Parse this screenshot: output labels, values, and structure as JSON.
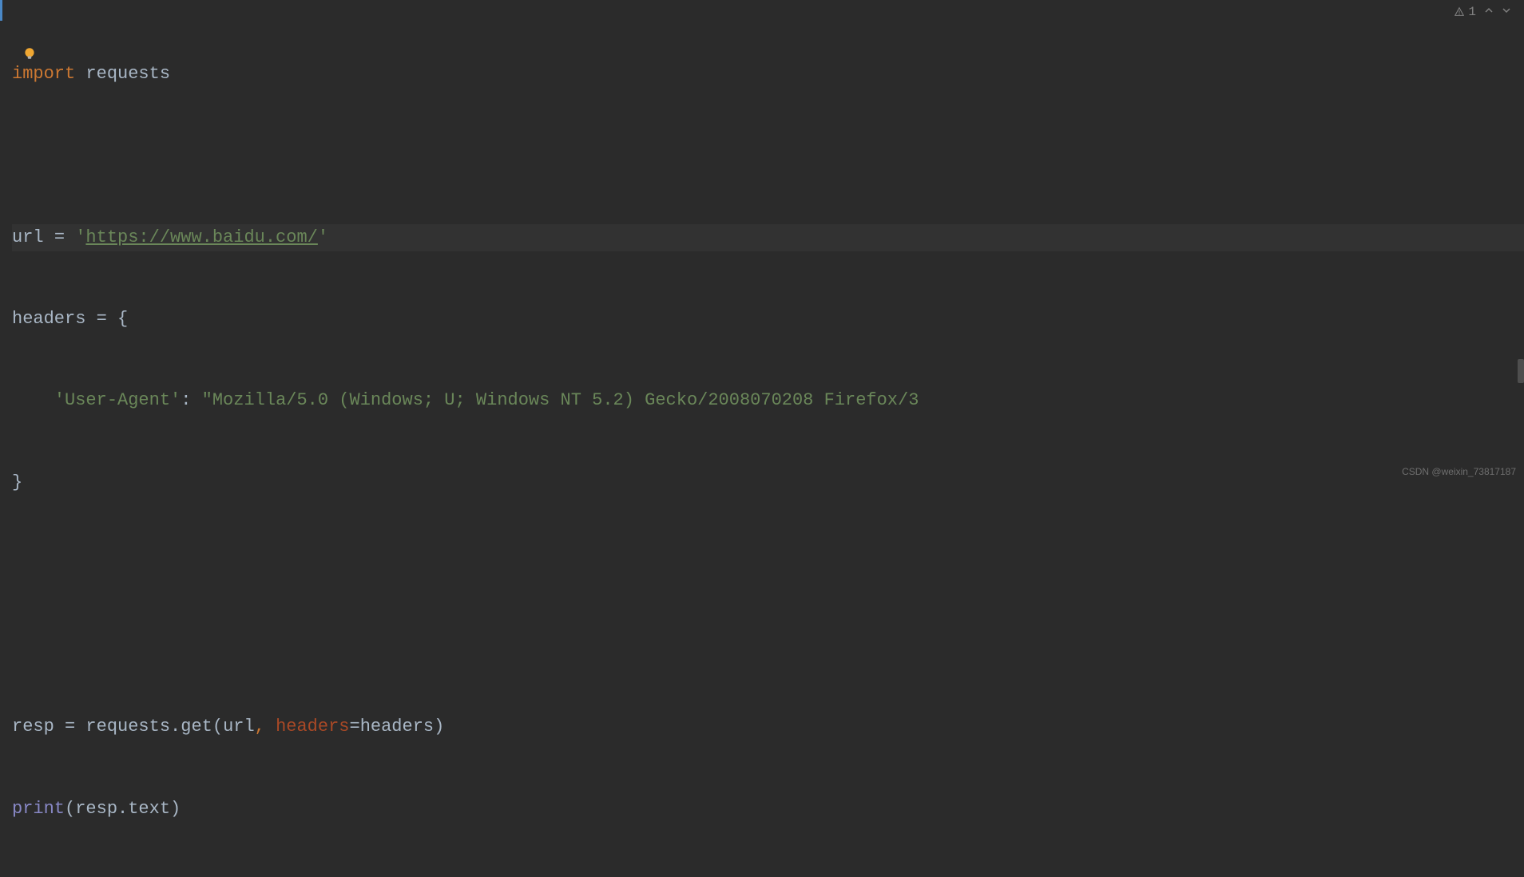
{
  "topbar": {
    "warning_count": "1",
    "chevron_up": "^",
    "chevron_down": "v"
  },
  "code": {
    "line1": {
      "import_kw": "import",
      "module": " requests"
    },
    "line3": {
      "var": "url ",
      "eq": "= ",
      "quote_open": "'",
      "url_text": "https://www.baidu.com/",
      "quote_close": "'"
    },
    "line4": {
      "var": "headers ",
      "eq": "= ",
      "brace": "{"
    },
    "line5": {
      "indent": "    ",
      "key": "'User-Agent'",
      "colon": ": ",
      "value": "\"Mozilla/5.0 (Windows; U; Windows NT 5.2) Gecko/2008070208 Firefox/3"
    },
    "line6": {
      "brace": "}"
    },
    "line8": {
      "var": "resp ",
      "eq": "= ",
      "obj": "requests",
      "dot": ".",
      "method": "get",
      "paren_open": "(",
      "arg1": "url",
      "comma": ", ",
      "param": "headers",
      "assign": "=",
      "arg2": "headers",
      "paren_close": ")"
    },
    "line9": {
      "func": "print",
      "paren_open": "(",
      "obj": "resp",
      "dot": ".",
      "attr": "text",
      "paren_close": ")"
    }
  },
  "watermark": "CSDN @weixin_73817187"
}
